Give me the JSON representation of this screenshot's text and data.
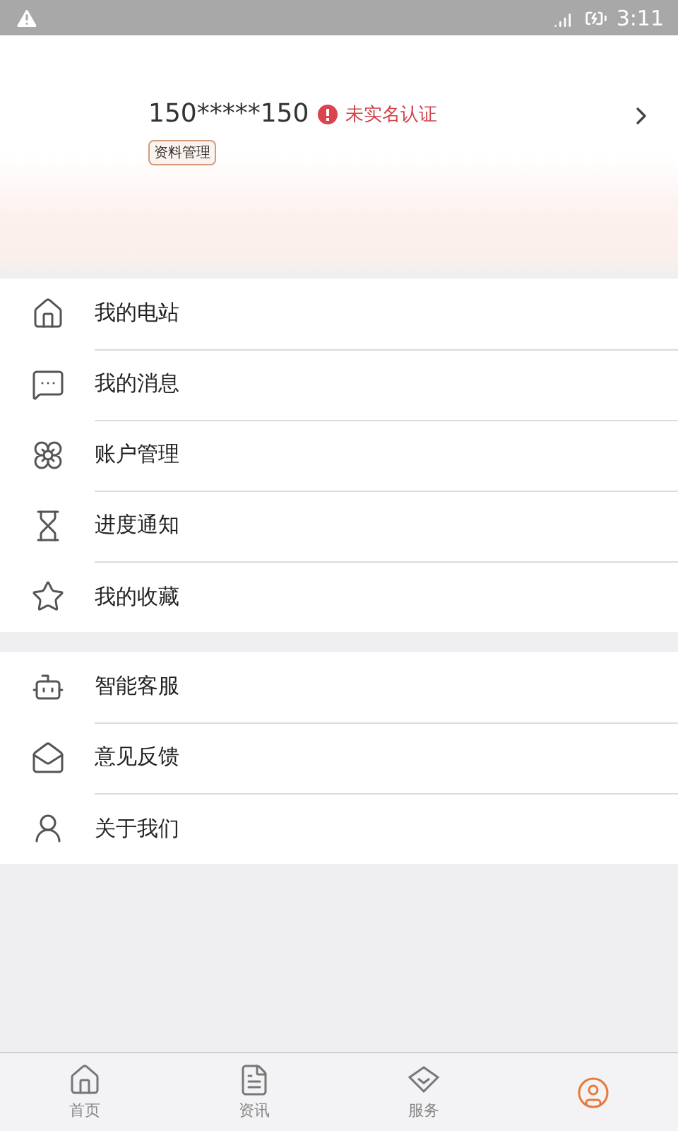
{
  "status_bar": {
    "time": "3:11"
  },
  "profile": {
    "phone": "150*****150",
    "verification": "未实名认证",
    "tag": "资料管理"
  },
  "menu_groups": [
    {
      "items": [
        {
          "label": "我的电站"
        },
        {
          "label": "我的消息"
        },
        {
          "label": "账户管理"
        },
        {
          "label": "进度通知"
        },
        {
          "label": "我的收藏"
        }
      ]
    },
    {
      "items": [
        {
          "label": "智能客服"
        },
        {
          "label": "意见反馈"
        },
        {
          "label": "关于我们"
        }
      ]
    }
  ],
  "tab_bar": [
    {
      "label": "首页",
      "selected": false
    },
    {
      "label": "资讯",
      "selected": false
    },
    {
      "label": "服务",
      "selected": false
    },
    {
      "selected": true
    }
  ]
}
